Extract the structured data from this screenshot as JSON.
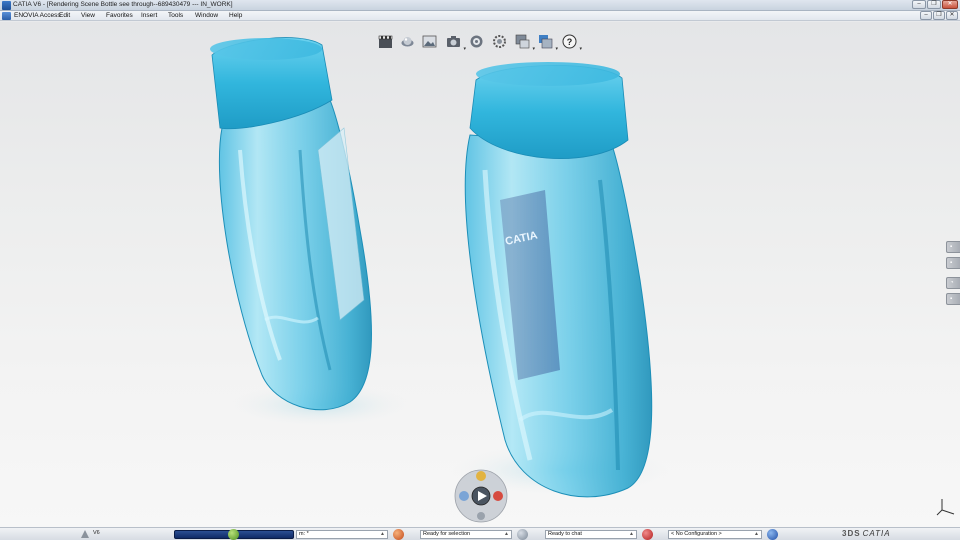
{
  "window": {
    "title": "CATIA V6 - [Rendering Scene Bottle see through--689430479 --- IN_WORK]",
    "buttons": [
      "–",
      "❐",
      "✕"
    ]
  },
  "menu": {
    "items": [
      "ENOVIA Access",
      "Edit",
      "View",
      "Favorites",
      "Insert",
      "Tools",
      "Window",
      "Help"
    ]
  },
  "toolbar": {
    "icons": [
      "clapperboard-icon",
      "render-sphere-icon",
      "image-frame-icon",
      "camera-icon",
      "gear-wheel-icon",
      "settings-gear-icon",
      "screen-capture-icon",
      "scene-library-icon",
      "help-icon"
    ],
    "help_glyph": "?"
  },
  "scene": {
    "label_text": "CATIA",
    "colors": {
      "cap": "#31b6dd",
      "bottle": "#5ec8e8",
      "liquid": "#2aa7cf",
      "background": "#eceded"
    }
  },
  "robot": {
    "play_glyph": "▶"
  },
  "statusbar": {
    "version": "V6",
    "command_field": "m: *",
    "status_field": "Ready for selection",
    "chat_field": "Ready to chat",
    "config_field": "< No Configuration >",
    "brand": "CATIA",
    "arrow": "▲"
  }
}
